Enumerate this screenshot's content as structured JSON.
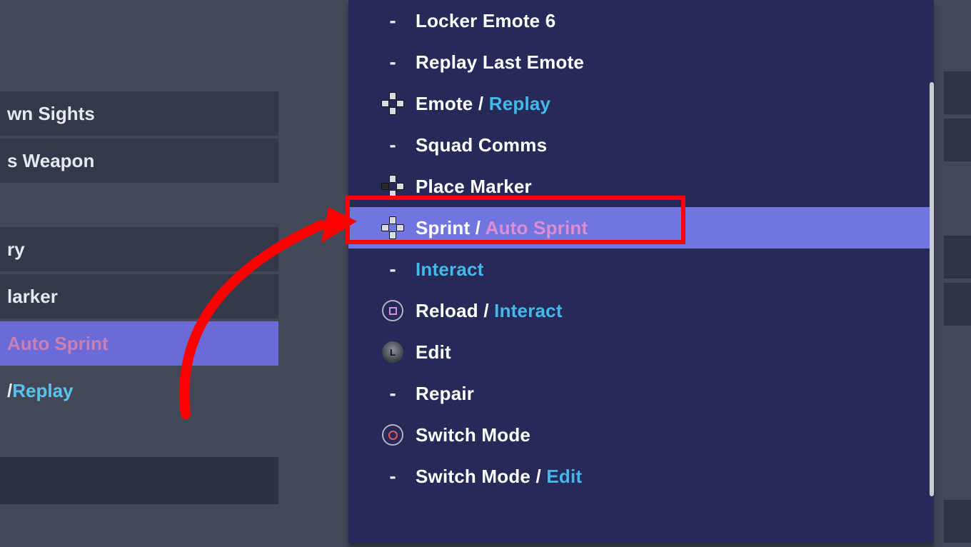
{
  "left": {
    "r0": "wn Sights",
    "r1": "s Weapon",
    "r2": "ry",
    "r3": "larker",
    "r4a": "Auto Sprint",
    "r5a": "/ ",
    "r5b": "Replay"
  },
  "list": {
    "r0": {
      "label": "Locker Emote 6"
    },
    "r1": {
      "label": "Replay Last Emote"
    },
    "r2": {
      "label": "Emote",
      "sep": " / ",
      "alt": "Replay"
    },
    "r3": {
      "label": "Squad Comms"
    },
    "r4": {
      "label": "Place Marker"
    },
    "r5": {
      "label": "Sprint",
      "sep": " / ",
      "alt": "Auto Sprint"
    },
    "r6": {
      "alt": "Interact"
    },
    "r7": {
      "label": "Reload",
      "sep": " / ",
      "alt": "Interact"
    },
    "r8": {
      "label": "Edit"
    },
    "r9": {
      "label": "Repair"
    },
    "r10": {
      "label": "Switch Mode"
    },
    "r11": {
      "label": "Switch Mode",
      "sep": " / ",
      "alt": "Edit"
    }
  },
  "annotation": {
    "highlight_target": "Sprint / Auto Sprint"
  }
}
